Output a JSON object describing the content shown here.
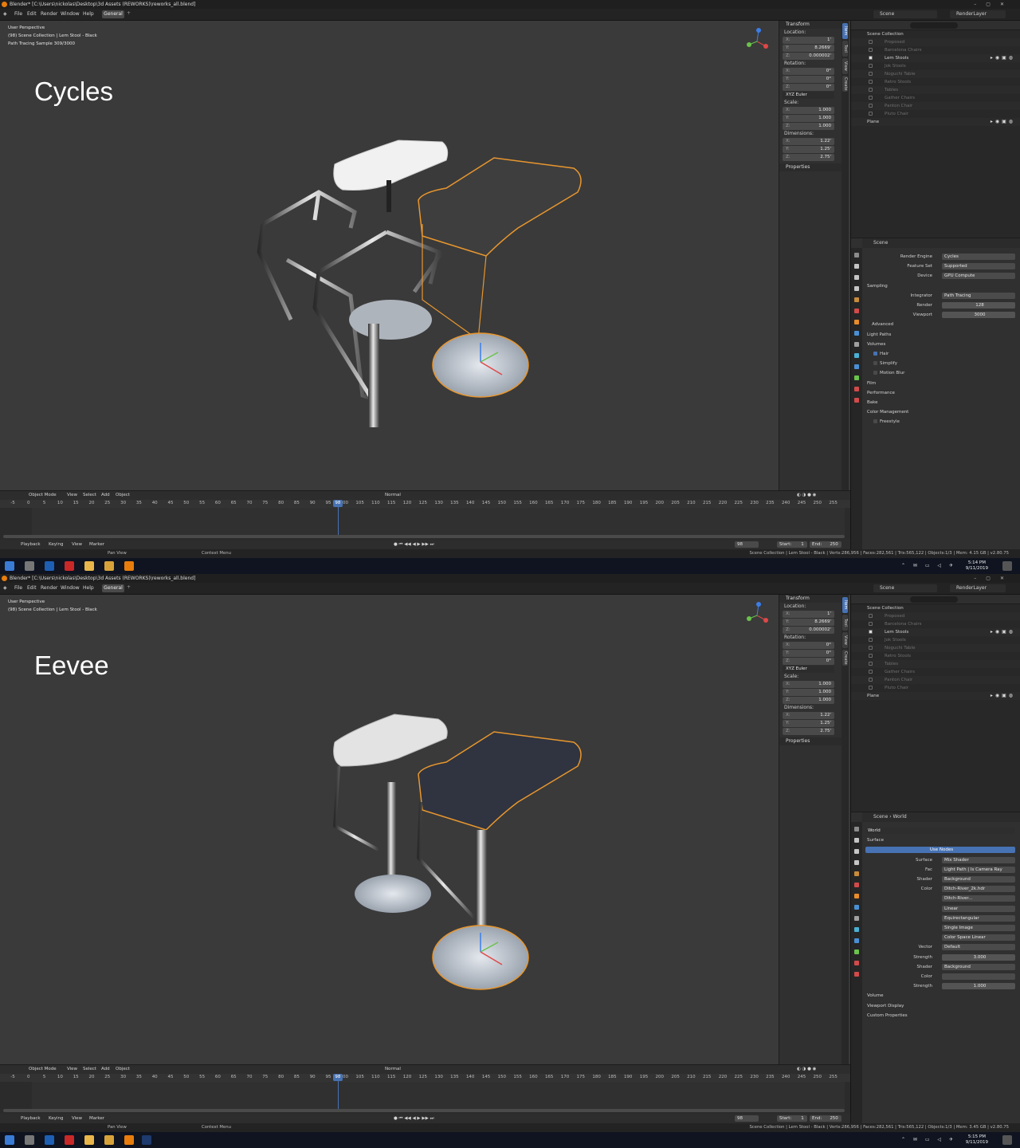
{
  "screens": [
    {
      "title": "Blender* [C:\\Users\\nickolas\\Desktop\\3d Assets (REWORKS)\\reworks_all.blend]",
      "menu": [
        "File",
        "Edit",
        "Render",
        "Window",
        "Help"
      ],
      "workspace_tab": "General",
      "scene_name": "Scene",
      "render_layer": "RenderLayer",
      "viewport_info": [
        "User Perspective",
        "(98) Scene Collection | Lem Stool - Black",
        "Path Tracing Sample 309/3000"
      ],
      "big_label": "Cycles",
      "transform": {
        "header": "Transform",
        "location_label": "Location:",
        "location": {
          "x": "1'",
          "y": "8.2669'",
          "z": "0.000002'"
        },
        "rotation_label": "Rotation:",
        "rotation": {
          "x": "0°",
          "y": "0°",
          "z": "0°"
        },
        "rotation_mode": "XYZ Euler",
        "scale_label": "Scale:",
        "scale": {
          "x": "1.000",
          "y": "1.000",
          "z": "1.000"
        },
        "dimensions_label": "Dimensions:",
        "dimensions": {
          "x": "1.22'",
          "y": "1.25'",
          "z": "2.75'"
        },
        "properties": "Properties"
      },
      "side_tabs": [
        "Item",
        "Tool",
        "View",
        "Create"
      ],
      "outliner": [
        {
          "name": "Scene Collection",
          "level": 0,
          "dim": false,
          "check": "none",
          "icons": ""
        },
        {
          "name": "Proposed",
          "level": 1,
          "dim": true,
          "check": "off",
          "icons": ""
        },
        {
          "name": "Barcelona Chairs",
          "level": 1,
          "dim": true,
          "check": "off",
          "icons": ""
        },
        {
          "name": "Lem Stools",
          "level": 1,
          "dim": false,
          "check": "on",
          "icons": "▸◉▣◍"
        },
        {
          "name": "Jok Stools",
          "level": 1,
          "dim": true,
          "check": "off",
          "icons": ""
        },
        {
          "name": "Noguchi Table",
          "level": 1,
          "dim": true,
          "check": "off",
          "icons": ""
        },
        {
          "name": "Retro Stools",
          "level": 1,
          "dim": true,
          "check": "off",
          "icons": ""
        },
        {
          "name": "Tables",
          "level": 1,
          "dim": true,
          "check": "off",
          "icons": ""
        },
        {
          "name": "Gather Chairs",
          "level": 1,
          "dim": true,
          "check": "off",
          "icons": ""
        },
        {
          "name": "Panton Chair",
          "level": 1,
          "dim": true,
          "check": "off",
          "icons": ""
        },
        {
          "name": "Pluto Chair",
          "level": 1,
          "dim": true,
          "check": "off",
          "icons": ""
        },
        {
          "name": "Plane",
          "level": 0,
          "dim": false,
          "check": "none",
          "icons": "▸◉▣◍"
        }
      ],
      "props_header": "Scene",
      "props_rows": [
        {
          "kind": "field",
          "label": "Render Engine",
          "value": "Cycles"
        },
        {
          "kind": "field",
          "label": "Feature Set",
          "value": "Supported"
        },
        {
          "kind": "field",
          "label": "Device",
          "value": "GPU Compute"
        },
        {
          "kind": "section",
          "label": "Sampling"
        },
        {
          "kind": "field",
          "label": "Integrator",
          "value": "Path Tracing"
        },
        {
          "kind": "num",
          "label": "Render",
          "value": "128"
        },
        {
          "kind": "num",
          "label": "Viewport",
          "value": "3000"
        },
        {
          "kind": "sub",
          "label": "Advanced"
        },
        {
          "kind": "section",
          "label": "Light Paths"
        },
        {
          "kind": "section",
          "label": "Volumes"
        },
        {
          "kind": "check",
          "label": "Hair",
          "on": true
        },
        {
          "kind": "check",
          "label": "Simplify",
          "on": false
        },
        {
          "kind": "check",
          "label": "Motion Blur",
          "on": false
        },
        {
          "kind": "section",
          "label": "Film"
        },
        {
          "kind": "section",
          "label": "Performance"
        },
        {
          "kind": "section",
          "label": "Bake"
        },
        {
          "kind": "section",
          "label": "Color Management"
        },
        {
          "kind": "check",
          "label": "Freestyle",
          "on": false
        }
      ],
      "toolbar": {
        "mode": "Object Mode",
        "items": [
          "View",
          "Select",
          "Add",
          "Object"
        ],
        "orientation": "Normal"
      },
      "timeline": {
        "ticks": [
          -5,
          0,
          5,
          10,
          15,
          20,
          25,
          30,
          35,
          40,
          45,
          50,
          55,
          60,
          65,
          70,
          75,
          80,
          85,
          90,
          95,
          100,
          105,
          110,
          115,
          120,
          125,
          130,
          135,
          140,
          145,
          150,
          155,
          160,
          165,
          170,
          175,
          180,
          185,
          190,
          195,
          200,
          205,
          210,
          215,
          220,
          225,
          230,
          235,
          240,
          245,
          250,
          255
        ],
        "current": 98
      },
      "timeline_bar": {
        "items": [
          "Playback",
          "Keying",
          "View",
          "Marker"
        ],
        "frame": "98",
        "start": "Start:",
        "start_val": "1",
        "end": "End:",
        "end_val": "250"
      },
      "status": {
        "left": "Pan View",
        "mid": "Context Menu",
        "right": "Scene Collection | Lem Stool - Black | Verts:286,956 | Faces:282,561 | Tris:565,122 | Objects:1/3 | Mem: 4.15 GB | v2.80.75"
      },
      "clock": {
        "time": "5:14 PM",
        "date": "9/11/2019"
      }
    },
    {
      "title": "Blender* [C:\\Users\\nickolas\\Desktop\\3d Assets (REWORKS)\\reworks_all.blend]",
      "menu": [
        "File",
        "Edit",
        "Render",
        "Window",
        "Help"
      ],
      "workspace_tab": "General",
      "scene_name": "Scene",
      "render_layer": "RenderLayer",
      "viewport_info": [
        "User Perspective",
        "(98) Scene Collection | Lem Stool - Black"
      ],
      "big_label": "Eevee",
      "transform": {
        "header": "Transform",
        "location_label": "Location:",
        "location": {
          "x": "1'",
          "y": "8.2669'",
          "z": "0.000002'"
        },
        "rotation_label": "Rotation:",
        "rotation": {
          "x": "0°",
          "y": "0°",
          "z": "0°"
        },
        "rotation_mode": "XYZ Euler",
        "scale_label": "Scale:",
        "scale": {
          "x": "1.000",
          "y": "1.000",
          "z": "1.000"
        },
        "dimensions_label": "Dimensions:",
        "dimensions": {
          "x": "1.22'",
          "y": "1.25'",
          "z": "2.75'"
        },
        "properties": "Properties"
      },
      "side_tabs": [
        "Item",
        "Tool",
        "View",
        "Create"
      ],
      "outliner": [
        {
          "name": "Scene Collection",
          "level": 0,
          "dim": false,
          "check": "none",
          "icons": ""
        },
        {
          "name": "Proposed",
          "level": 1,
          "dim": true,
          "check": "off",
          "icons": ""
        },
        {
          "name": "Barcelona Chairs",
          "level": 1,
          "dim": true,
          "check": "off",
          "icons": ""
        },
        {
          "name": "Lem Stools",
          "level": 1,
          "dim": false,
          "check": "on",
          "icons": "▸◉▣◍"
        },
        {
          "name": "Jok Stools",
          "level": 1,
          "dim": true,
          "check": "off",
          "icons": ""
        },
        {
          "name": "Noguchi Table",
          "level": 1,
          "dim": true,
          "check": "off",
          "icons": ""
        },
        {
          "name": "Retro Stools",
          "level": 1,
          "dim": true,
          "check": "off",
          "icons": ""
        },
        {
          "name": "Tables",
          "level": 1,
          "dim": true,
          "check": "off",
          "icons": ""
        },
        {
          "name": "Gather Chairs",
          "level": 1,
          "dim": true,
          "check": "off",
          "icons": ""
        },
        {
          "name": "Panton Chair",
          "level": 1,
          "dim": true,
          "check": "off",
          "icons": ""
        },
        {
          "name": "Pluto Chair",
          "level": 1,
          "dim": true,
          "check": "off",
          "icons": ""
        },
        {
          "name": "Plane",
          "level": 0,
          "dim": false,
          "check": "none",
          "icons": "▸◉▣◍"
        }
      ],
      "props_header": "Scene   ›   World",
      "props_rows": [
        {
          "kind": "dark",
          "label": "",
          "value": "World"
        },
        {
          "kind": "section",
          "label": "Surface"
        },
        {
          "kind": "blue",
          "label": "",
          "value": "Use Nodes"
        },
        {
          "kind": "field",
          "label": "Surface",
          "value": "Mix Shader"
        },
        {
          "kind": "field",
          "label": "Fac",
          "value": "Light Path | Is Camera Ray"
        },
        {
          "kind": "field",
          "label": "Shader",
          "value": "Background"
        },
        {
          "kind": "field",
          "label": "Color",
          "value": "Ditch-River_2k.hdr"
        },
        {
          "kind": "field",
          "label": "",
          "value": "Ditch-River..."
        },
        {
          "kind": "field",
          "label": "",
          "value": "Linear"
        },
        {
          "kind": "field",
          "label": "",
          "value": "Equirectangular"
        },
        {
          "kind": "field",
          "label": "",
          "value": "Single Image"
        },
        {
          "kind": "field",
          "label": "",
          "value": "Color Space    Linear"
        },
        {
          "kind": "field",
          "label": "Vector",
          "value": "Default"
        },
        {
          "kind": "num",
          "label": "Strength",
          "value": "3.000"
        },
        {
          "kind": "field",
          "label": "Shader",
          "value": "Background"
        },
        {
          "kind": "field",
          "label": "Color",
          "value": ""
        },
        {
          "kind": "num",
          "label": "Strength",
          "value": "1.000"
        },
        {
          "kind": "section",
          "label": "Volume"
        },
        {
          "kind": "section",
          "label": "Viewport Display"
        },
        {
          "kind": "section",
          "label": "Custom Properties"
        }
      ],
      "toolbar": {
        "mode": "Object Mode",
        "items": [
          "View",
          "Select",
          "Add",
          "Object"
        ],
        "orientation": "Normal"
      },
      "timeline": {
        "ticks": [
          -5,
          0,
          5,
          10,
          15,
          20,
          25,
          30,
          35,
          40,
          45,
          50,
          55,
          60,
          65,
          70,
          75,
          80,
          85,
          90,
          95,
          100,
          105,
          110,
          115,
          120,
          125,
          130,
          135,
          140,
          145,
          150,
          155,
          160,
          165,
          170,
          175,
          180,
          185,
          190,
          195,
          200,
          205,
          210,
          215,
          220,
          225,
          230,
          235,
          240,
          245,
          250,
          255
        ],
        "current": 98
      },
      "timeline_bar": {
        "items": [
          "Playback",
          "Keying",
          "View",
          "Marker"
        ],
        "frame": "98",
        "start": "Start:",
        "start_val": "1",
        "end": "End:",
        "end_val": "250"
      },
      "status": {
        "left": "Pan View",
        "mid": "Context Menu",
        "right": "Scene Collection | Lem Stool - Black | Verts:286,956 | Faces:282,561 | Tris:565,122 | Objects:1/3 | Mem: 3.45 GB | v2.80.75"
      },
      "clock": {
        "time": "5:15 PM",
        "date": "9/11/2019"
      }
    }
  ],
  "colors": {
    "accent": "#4772b3",
    "selection_outline": "#e8962e",
    "viewport_bg": "#3a3a3a"
  }
}
